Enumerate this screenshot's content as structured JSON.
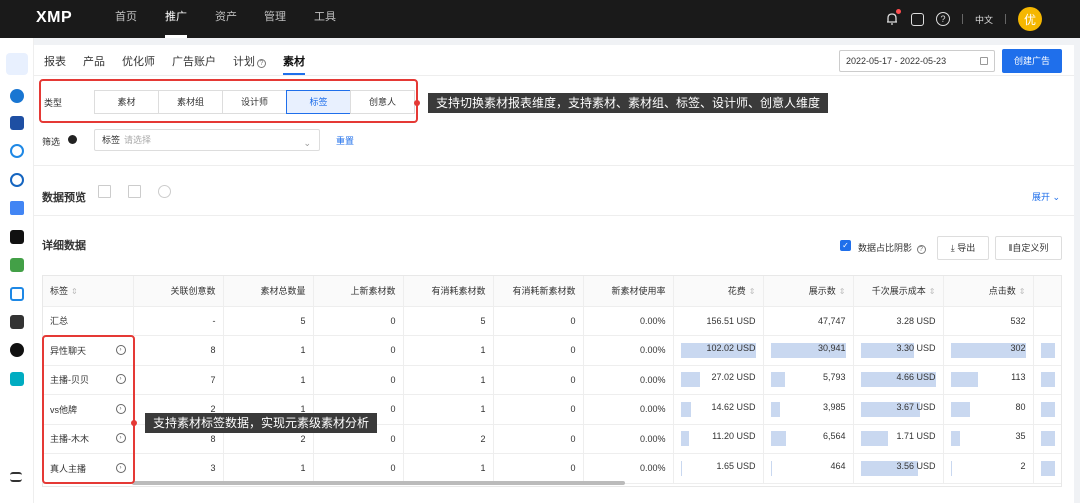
{
  "header": {
    "logo": "XMP",
    "nav": [
      {
        "label": "首页",
        "active": false
      },
      {
        "label": "推广",
        "active": true
      },
      {
        "label": "资产",
        "active": false
      },
      {
        "label": "管理",
        "active": false
      },
      {
        "label": "工具",
        "active": false
      }
    ],
    "lang": "中文",
    "avatar": "优"
  },
  "tabs": [
    {
      "label": "报表"
    },
    {
      "label": "产品"
    },
    {
      "label": "优化师"
    },
    {
      "label": "广告账户"
    },
    {
      "label": "计划"
    },
    {
      "label": "素材"
    }
  ],
  "date_range": "2022-05-17 - 2022-05-23",
  "create_button": "创建广告",
  "type_label": "类型",
  "type_options": [
    {
      "label": "素材"
    },
    {
      "label": "素材组"
    },
    {
      "label": "设计师"
    },
    {
      "label": "标签"
    },
    {
      "label": "创意人"
    }
  ],
  "callout_top": "支持切换素材报表维度，支持素材、素材组、标签、设计师、创意人维度",
  "callout_table": "支持素材标签数据，实现元素级素材分析",
  "filter": {
    "label": "筛选",
    "field": "标签",
    "placeholder": "请选择",
    "reset": "重置"
  },
  "preview_title": "数据预览",
  "expand": "展开",
  "detail_title": "详细数据",
  "shadow_label": "数据占比阴影",
  "export_label": "导出",
  "custom_cols": "自定义列",
  "table": {
    "headers": [
      "标签",
      "关联创意数",
      "素材总数量",
      "上新素材数",
      "有消耗素材数",
      "有消耗新素材数",
      "新素材使用率",
      "花费",
      "展示数",
      "千次展示成本",
      "点击数"
    ],
    "rows": [
      [
        "汇总",
        "-",
        "5",
        "0",
        "5",
        "0",
        "0.00%",
        "156.51 USD",
        "47,747",
        "3.28 USD",
        "532"
      ],
      [
        "异性聊天",
        "8",
        "1",
        "0",
        "1",
        "0",
        "0.00%",
        "102.02 USD",
        "30,941",
        "3.30 USD",
        "302"
      ],
      [
        "主播-贝贝",
        "7",
        "1",
        "0",
        "1",
        "0",
        "0.00%",
        "27.02 USD",
        "5,793",
        "4.66 USD",
        "113"
      ],
      [
        "vs他牌",
        "2",
        "1",
        "0",
        "1",
        "0",
        "0.00%",
        "14.62 USD",
        "3,985",
        "3.67 USD",
        "80"
      ],
      [
        "主播-木木",
        "8",
        "2",
        "0",
        "2",
        "0",
        "0.00%",
        "11.20 USD",
        "6,564",
        "1.71 USD",
        "35"
      ],
      [
        "真人主播",
        "3",
        "1",
        "0",
        "1",
        "0",
        "0.00%",
        "1.65 USD",
        "464",
        "3.56 USD",
        "2"
      ]
    ],
    "bars": {
      "spend": [
        1.0,
        0.26,
        0.14,
        0.11,
        0.016
      ],
      "impressions": [
        1.0,
        0.19,
        0.13,
        0.21,
        0.015
      ],
      "cpm": [
        0.71,
        1.0,
        0.79,
        0.37,
        0.76
      ],
      "clicks": [
        1.0,
        0.37,
        0.26,
        0.12,
        0.007
      ]
    }
  },
  "colors": {
    "accent": "#1f6feb",
    "highlight": "#e53935",
    "bar": "#c9d8f0"
  }
}
